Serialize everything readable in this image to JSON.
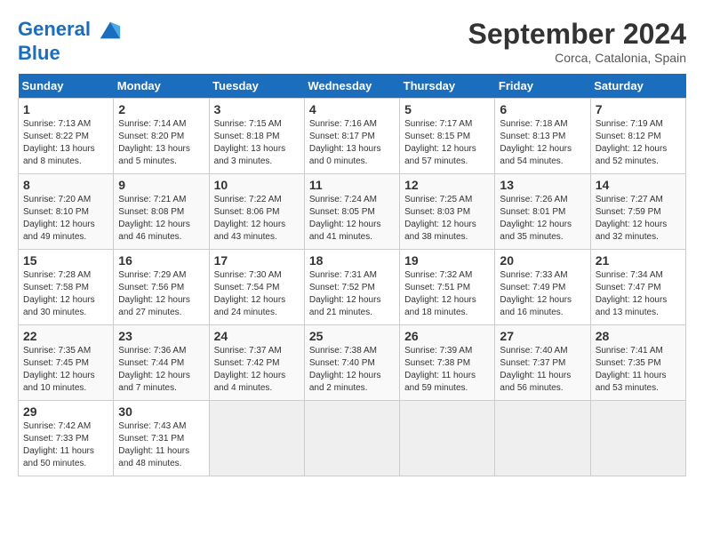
{
  "header": {
    "logo_line1": "General",
    "logo_line2": "Blue",
    "month": "September 2024",
    "location": "Corca, Catalonia, Spain"
  },
  "days_of_week": [
    "Sunday",
    "Monday",
    "Tuesday",
    "Wednesday",
    "Thursday",
    "Friday",
    "Saturday"
  ],
  "weeks": [
    [
      {
        "day": 1,
        "sunrise": "7:13 AM",
        "sunset": "8:22 PM",
        "daylight": "13 hours and 8 minutes"
      },
      {
        "day": 2,
        "sunrise": "7:14 AM",
        "sunset": "8:20 PM",
        "daylight": "13 hours and 5 minutes"
      },
      {
        "day": 3,
        "sunrise": "7:15 AM",
        "sunset": "8:18 PM",
        "daylight": "13 hours and 3 minutes"
      },
      {
        "day": 4,
        "sunrise": "7:16 AM",
        "sunset": "8:17 PM",
        "daylight": "13 hours and 0 minutes"
      },
      {
        "day": 5,
        "sunrise": "7:17 AM",
        "sunset": "8:15 PM",
        "daylight": "12 hours and 57 minutes"
      },
      {
        "day": 6,
        "sunrise": "7:18 AM",
        "sunset": "8:13 PM",
        "daylight": "12 hours and 54 minutes"
      },
      {
        "day": 7,
        "sunrise": "7:19 AM",
        "sunset": "8:12 PM",
        "daylight": "12 hours and 52 minutes"
      }
    ],
    [
      {
        "day": 8,
        "sunrise": "7:20 AM",
        "sunset": "8:10 PM",
        "daylight": "12 hours and 49 minutes"
      },
      {
        "day": 9,
        "sunrise": "7:21 AM",
        "sunset": "8:08 PM",
        "daylight": "12 hours and 46 minutes"
      },
      {
        "day": 10,
        "sunrise": "7:22 AM",
        "sunset": "8:06 PM",
        "daylight": "12 hours and 43 minutes"
      },
      {
        "day": 11,
        "sunrise": "7:24 AM",
        "sunset": "8:05 PM",
        "daylight": "12 hours and 41 minutes"
      },
      {
        "day": 12,
        "sunrise": "7:25 AM",
        "sunset": "8:03 PM",
        "daylight": "12 hours and 38 minutes"
      },
      {
        "day": 13,
        "sunrise": "7:26 AM",
        "sunset": "8:01 PM",
        "daylight": "12 hours and 35 minutes"
      },
      {
        "day": 14,
        "sunrise": "7:27 AM",
        "sunset": "7:59 PM",
        "daylight": "12 hours and 32 minutes"
      }
    ],
    [
      {
        "day": 15,
        "sunrise": "7:28 AM",
        "sunset": "7:58 PM",
        "daylight": "12 hours and 30 minutes"
      },
      {
        "day": 16,
        "sunrise": "7:29 AM",
        "sunset": "7:56 PM",
        "daylight": "12 hours and 27 minutes"
      },
      {
        "day": 17,
        "sunrise": "7:30 AM",
        "sunset": "7:54 PM",
        "daylight": "12 hours and 24 minutes"
      },
      {
        "day": 18,
        "sunrise": "7:31 AM",
        "sunset": "7:52 PM",
        "daylight": "12 hours and 21 minutes"
      },
      {
        "day": 19,
        "sunrise": "7:32 AM",
        "sunset": "7:51 PM",
        "daylight": "12 hours and 18 minutes"
      },
      {
        "day": 20,
        "sunrise": "7:33 AM",
        "sunset": "7:49 PM",
        "daylight": "12 hours and 16 minutes"
      },
      {
        "day": 21,
        "sunrise": "7:34 AM",
        "sunset": "7:47 PM",
        "daylight": "12 hours and 13 minutes"
      }
    ],
    [
      {
        "day": 22,
        "sunrise": "7:35 AM",
        "sunset": "7:45 PM",
        "daylight": "12 hours and 10 minutes"
      },
      {
        "day": 23,
        "sunrise": "7:36 AM",
        "sunset": "7:44 PM",
        "daylight": "12 hours and 7 minutes"
      },
      {
        "day": 24,
        "sunrise": "7:37 AM",
        "sunset": "7:42 PM",
        "daylight": "12 hours and 4 minutes"
      },
      {
        "day": 25,
        "sunrise": "7:38 AM",
        "sunset": "7:40 PM",
        "daylight": "12 hours and 2 minutes"
      },
      {
        "day": 26,
        "sunrise": "7:39 AM",
        "sunset": "7:38 PM",
        "daylight": "11 hours and 59 minutes"
      },
      {
        "day": 27,
        "sunrise": "7:40 AM",
        "sunset": "7:37 PM",
        "daylight": "11 hours and 56 minutes"
      },
      {
        "day": 28,
        "sunrise": "7:41 AM",
        "sunset": "7:35 PM",
        "daylight": "11 hours and 53 minutes"
      }
    ],
    [
      {
        "day": 29,
        "sunrise": "7:42 AM",
        "sunset": "7:33 PM",
        "daylight": "11 hours and 50 minutes"
      },
      {
        "day": 30,
        "sunrise": "7:43 AM",
        "sunset": "7:31 PM",
        "daylight": "11 hours and 48 minutes"
      },
      null,
      null,
      null,
      null,
      null
    ]
  ]
}
